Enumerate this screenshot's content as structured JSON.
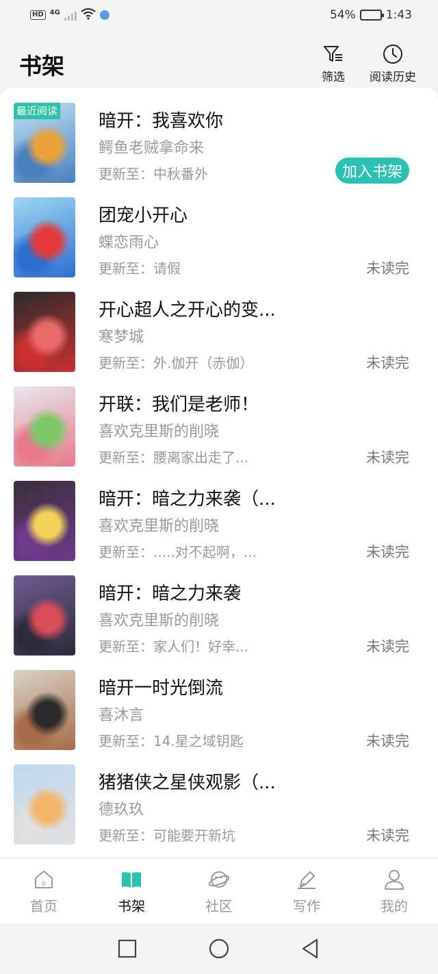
{
  "status_bar": {
    "hd": "HD",
    "network": "4G",
    "battery_text": "54%",
    "battery_level": 0.54,
    "time": "1:43"
  },
  "header": {
    "title": "书架",
    "filter_label": "筛选",
    "history_label": "阅读历史"
  },
  "books": [
    {
      "title": "暗开：我喜欢你",
      "author": "鳄鱼老贼拿命来",
      "update_label": "更新至：",
      "update": "中秋番外",
      "badge": "最近阅读",
      "action": "加入书架",
      "cover_colors": [
        "#bfe3f5",
        "#e9a33a",
        "#4a7fbf"
      ]
    },
    {
      "title": "团宠小开心",
      "author": "蝶恋雨心",
      "update_label": "更新至：",
      "update": "请假",
      "status": "未读完",
      "cover_colors": [
        "#9fd6f2",
        "#e33b3b",
        "#2d6fd1"
      ]
    },
    {
      "title": "开心超人之开心的变...",
      "author": "寒梦城",
      "update_label": "更新至：",
      "update": "外.伽开（赤伽）",
      "status": "未读完",
      "cover_colors": [
        "#2b2b2b",
        "#e86a6a",
        "#c93030"
      ]
    },
    {
      "title": "开联：我们是老师！",
      "author": "喜欢克里斯的削晓",
      "update_label": "更新至：",
      "update": "腰离家出走了...",
      "status": "未读完",
      "cover_colors": [
        "#e6e8ee",
        "#7cc86a",
        "#e77a8a"
      ]
    },
    {
      "title": "暗开：暗之力来袭（...",
      "author": "喜欢克里斯的削晓",
      "update_label": "更新至：",
      "update": ".....对不起啊，...",
      "status": "未读完",
      "cover_colors": [
        "#3a2f3a",
        "#f2d25a",
        "#6e3a8c"
      ]
    },
    {
      "title": "暗开：暗之力来袭",
      "author": "喜欢克里斯的削晓",
      "update_label": "更新至：",
      "update": "家人们！好幸...",
      "status": "未读完",
      "cover_colors": [
        "#6d5b8f",
        "#d94c5a",
        "#2b2b3a"
      ]
    },
    {
      "title": "暗开一时光倒流",
      "author": "喜沐言",
      "update_label": "更新至：",
      "update": "14.星之域钥匙",
      "status": "未读完",
      "cover_colors": [
        "#d8d2c6",
        "#2a2a2a",
        "#a86b4a"
      ]
    },
    {
      "title": "猪猪侠之星侠观影（...",
      "author": "德玖玖",
      "update_label": "更新至：",
      "update": "可能要开新坑",
      "status": "未读完",
      "cover_colors": [
        "#bfd9ef",
        "#f2b66a",
        "#e0e0e0"
      ]
    }
  ],
  "tabs": [
    {
      "label": "首页",
      "icon": "home-icon",
      "active": false
    },
    {
      "label": "书架",
      "icon": "book-icon",
      "active": true
    },
    {
      "label": "社区",
      "icon": "planet-icon",
      "active": false
    },
    {
      "label": "写作",
      "icon": "pen-icon",
      "active": false
    },
    {
      "label": "我的",
      "icon": "user-icon",
      "active": false
    }
  ],
  "colors": {
    "accent": "#2cc2b3",
    "badge": "#2cc2a8",
    "muted_text": "#999999"
  }
}
